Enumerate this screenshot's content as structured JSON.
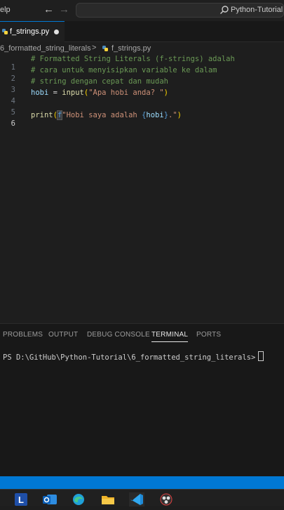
{
  "titlebar": {
    "menu_help": "elp",
    "search_placeholder": "Python-Tutorial"
  },
  "tab": {
    "label": "f_strings.py",
    "modified": true
  },
  "breadcrumb": {
    "folder": "6_formatted_string_literals",
    "separator": ">",
    "file": "f_strings.py"
  },
  "editor": {
    "lines": [
      {
        "num": "1",
        "comment": "# Formatted String Literals (f-strings) adalah"
      },
      {
        "num": "2",
        "comment": "# cara untuk menyisipkan variable ke dalam"
      },
      {
        "num": "3",
        "comment": "# string dengan cepat dan mudah"
      },
      {
        "num": "4",
        "var": "hobi",
        "eq": " = ",
        "func": "input",
        "open": "(",
        "str": "\"Apa hobi anda? \"",
        "close": ")"
      },
      {
        "num": "5"
      },
      {
        "num": "6",
        "func": "print",
        "open": "(",
        "prefix": "f",
        "str1": "\"Hobi saya adalah ",
        "lbrace": "{",
        "var": "hobi",
        "rbrace": "}",
        "str2": ".\"",
        "close": ")"
      }
    ]
  },
  "panel": {
    "tabs": [
      "PROBLEMS",
      "OUTPUT",
      "DEBUG CONSOLE",
      "TERMINAL",
      "PORTS"
    ],
    "active_tab": "TERMINAL",
    "terminal_prompt": "PS D:\\GitHub\\Python-Tutorial\\6_formatted_string_literals>"
  },
  "taskbar": {
    "apps": [
      "L",
      "outlook-icon",
      "edge-icon",
      "file-explorer-icon",
      "vscode-icon",
      "obs-icon"
    ]
  },
  "colors": {
    "accent": "#0078d4",
    "editor_bg": "#1e1e1e",
    "comment": "#6a9955",
    "string": "#ce9178",
    "function": "#dcdcaa",
    "variable": "#9cdcfe"
  }
}
